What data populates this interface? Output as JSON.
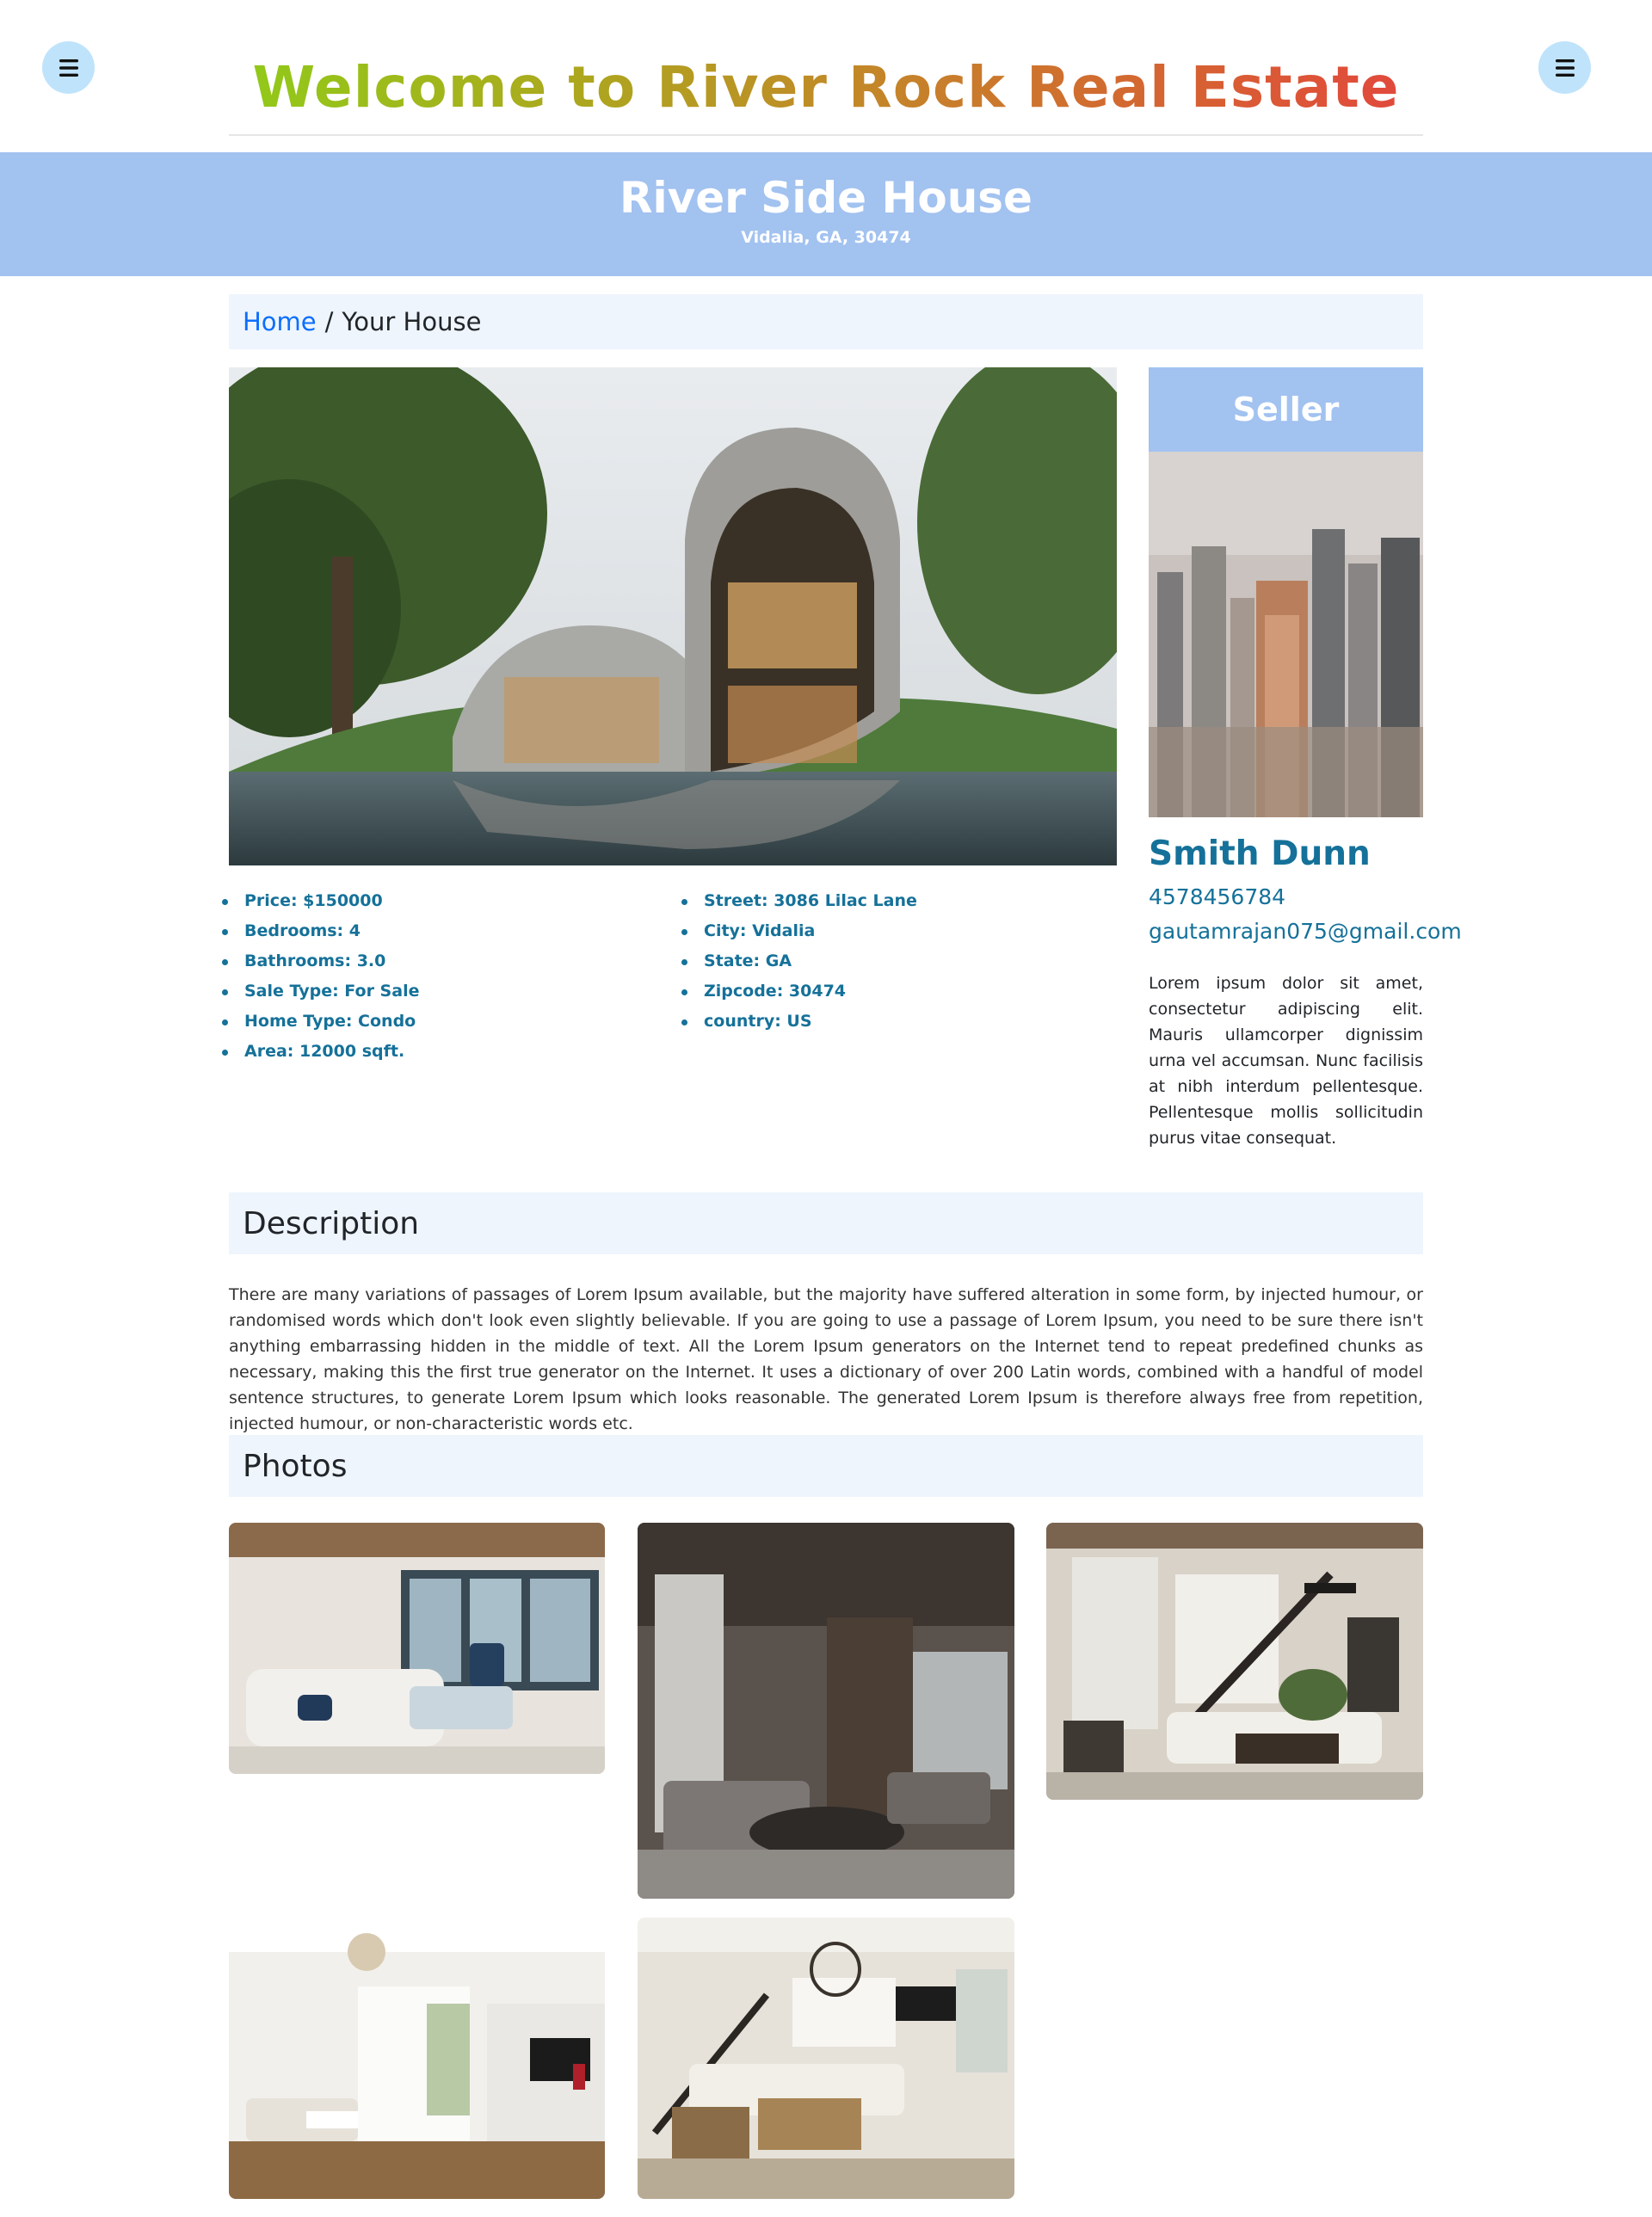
{
  "header": {
    "title": "Welcome to River Rock Real Estate",
    "left_menu_icon": "hamburger-menu-icon",
    "right_menu_icon": "hamburger-menu-icon"
  },
  "hero": {
    "title": "River Side House",
    "location": "Vidalia, GA, 30474"
  },
  "breadcrumb": {
    "home": "Home",
    "separator": "/",
    "current": "Your House"
  },
  "property": {
    "facts_left": [
      "Price: $150000",
      "Bedrooms: 4",
      "Bathrooms: 3.0",
      "Sale Type: For Sale",
      "Home Type: Condo",
      "Area: 12000 sqft."
    ],
    "facts_right": [
      "Street: 3086 Lilac Lane",
      "City: Vidalia",
      "State: GA",
      "Zipcode: 30474",
      "country: US"
    ]
  },
  "seller": {
    "heading": "Seller",
    "name": "Smith Dunn",
    "phone": "4578456784",
    "email": "gautamrajan075@gmail.com",
    "bio": "Lorem ipsum dolor sit amet, consectetur adipiscing elit. Mauris ullamcorper dignissim urna vel accumsan. Nunc facilisis at nibh interdum pellentesque. Pellentesque mollis sollicitudin purus vitae consequat."
  },
  "description": {
    "heading": "Description",
    "text": "There are many variations of passages of Lorem Ipsum available, but the majority have suffered alteration in some form, by injected humour, or randomised words which don't look even slightly believable. If you are going to use a passage of Lorem Ipsum, you need to be sure there isn't anything embarrassing hidden in the middle of text. All the Lorem Ipsum generators on the Internet tend to repeat predefined chunks as necessary, making this the first true generator on the Internet. It uses a dictionary of over 200 Latin words, combined with a handful of model sentence structures, to generate Lorem Ipsum which looks reasonable. The generated Lorem Ipsum is therefore always free from repetition, injected humour, or non-characteristic words etc."
  },
  "photos": {
    "heading": "Photos"
  },
  "colors": {
    "accent_blue": "#a2c2f0",
    "panel_bg": "#eef5fd",
    "fact_text": "#157199",
    "link": "#0d6efd",
    "menu_btn": "#bfe3fb"
  }
}
